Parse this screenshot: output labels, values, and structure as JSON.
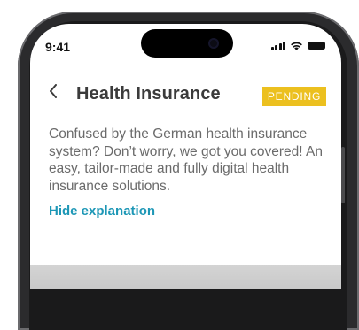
{
  "status_bar": {
    "time": "9:41",
    "icons": [
      "signal-icon",
      "wifi-icon",
      "battery-icon"
    ]
  },
  "header": {
    "back_icon": "chevron-left-icon",
    "title": "Health Insurance",
    "badge": "PENDING"
  },
  "content": {
    "explanation": "Confused by the German health insurance system? Don’t worry, we got you covered! An easy, tailor-made and fully digital health insurance solutions.",
    "hide_link": "Hide explanation"
  },
  "colors": {
    "badge_bg": "#ECC01F",
    "badge_text": "#FFFFFF",
    "link": "#1D97B6",
    "title": "#3B3B3B",
    "body_text": "#6B6B6B",
    "phone_frame": "#2B2B2D"
  }
}
